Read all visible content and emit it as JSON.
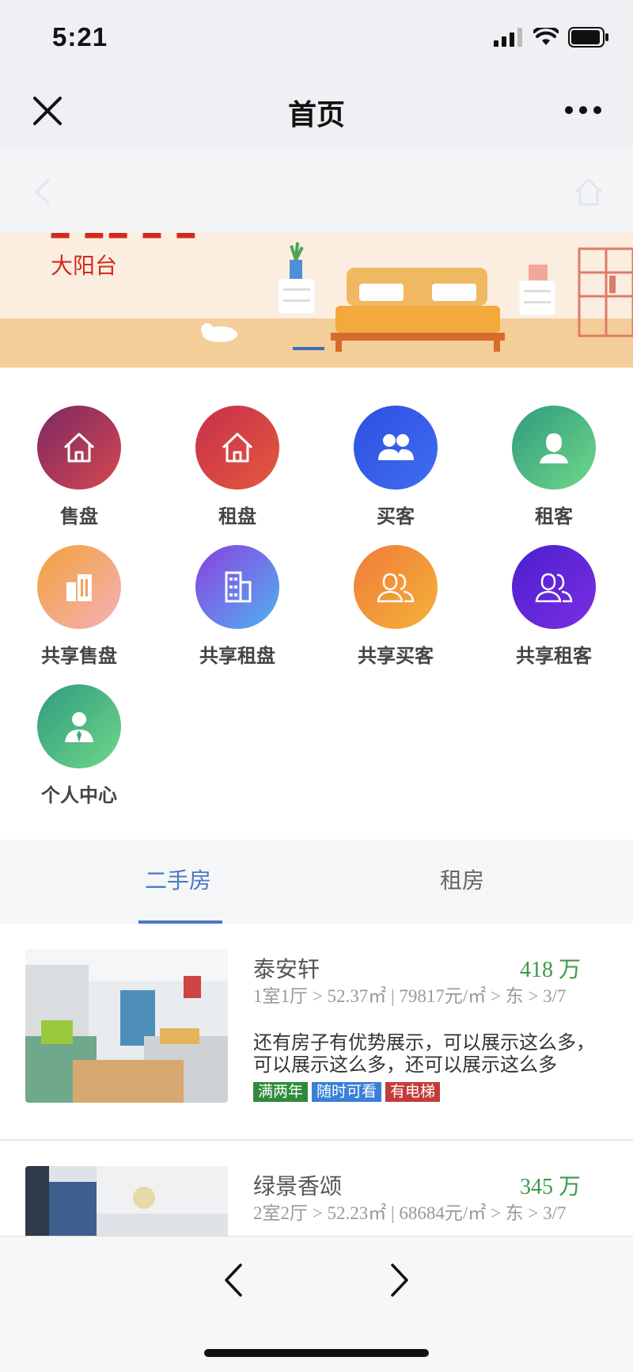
{
  "status_bar": {
    "time": "5:21"
  },
  "nav": {
    "title": "首页"
  },
  "banner": {
    "subtitle": "大阳台"
  },
  "grid": [
    {
      "label": "售盘",
      "icon": "house-icon"
    },
    {
      "label": "租盘",
      "icon": "house-icon"
    },
    {
      "label": "买客",
      "icon": "people-icon"
    },
    {
      "label": "租客",
      "icon": "person-icon"
    },
    {
      "label": "共享售盘",
      "icon": "buildings-icon"
    },
    {
      "label": "共享租盘",
      "icon": "building-icon"
    },
    {
      "label": "共享买客",
      "icon": "people-outline-icon"
    },
    {
      "label": "共享租客",
      "icon": "people-outline-icon"
    },
    {
      "label": "个人中心",
      "icon": "user-tie-icon"
    }
  ],
  "tabs": [
    {
      "label": "二手房",
      "active": true
    },
    {
      "label": "租房",
      "active": false
    }
  ],
  "listings": [
    {
      "name": "泰安轩",
      "price": "418 万",
      "meta": "1室1厅 > 52.37㎡ | 79817元/㎡ > 东 > 3/7",
      "desc": "还有房子有优势展示，可以展示这么多，可以展示这么多，还可以展示这么多",
      "tags": [
        "满两年",
        "随时可看",
        "有电梯"
      ]
    },
    {
      "name": "绿景香颂",
      "price": "345 万",
      "meta": "2室2厅 > 52.23㎡ | 68684元/㎡ > 东 > 3/7",
      "desc": "",
      "tags": []
    }
  ],
  "colors": {
    "accent_blue": "#4a79c4",
    "price_green": "#3d9a4a",
    "banner_red": "#d52b1e"
  }
}
